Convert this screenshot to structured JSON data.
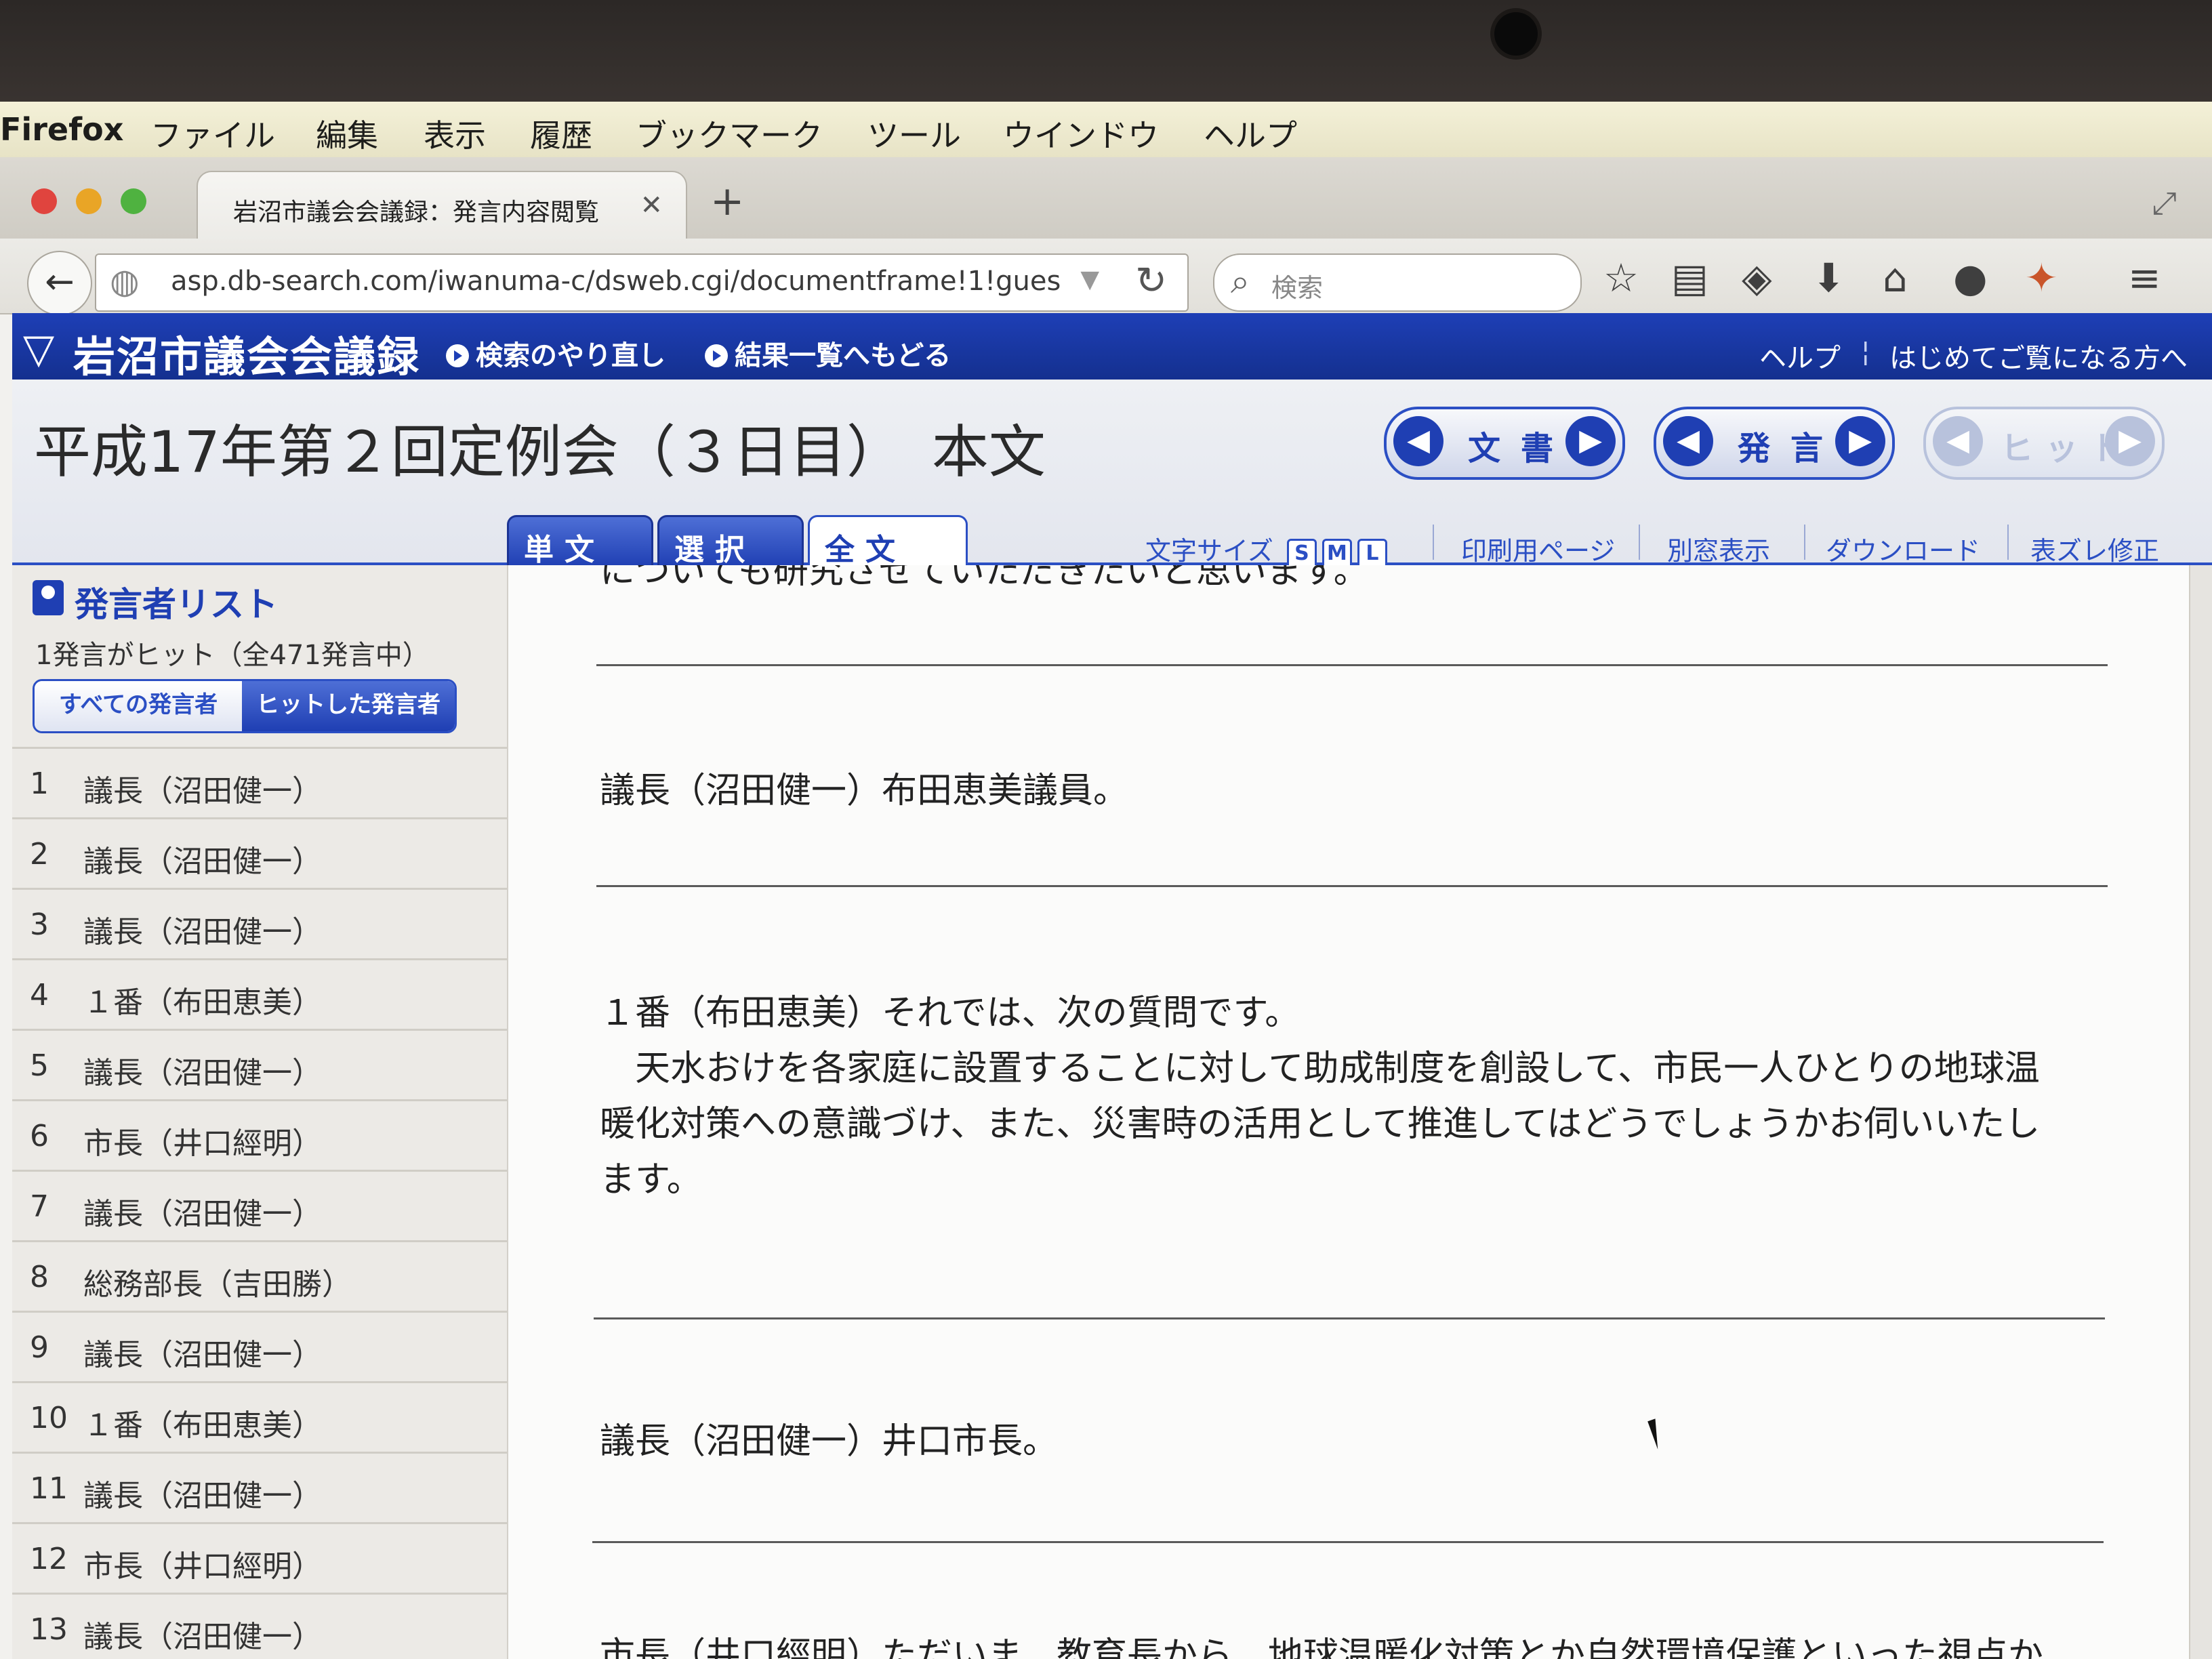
{
  "menubar": {
    "app_name": "Firefox",
    "items": [
      "ファイル",
      "編集",
      "表示",
      "履歴",
      "ブックマーク",
      "ツール",
      "ウインドウ",
      "ヘルプ"
    ]
  },
  "browser": {
    "tab_title": "岩沼市議会会議録：発言内容閲覧",
    "url": "asp.db-search.com/iwanuma-c/dsweb.cgi/documentframe!1!gues",
    "search_placeholder": "検索"
  },
  "site": {
    "logo": "岩沼市議会会議録",
    "links": [
      "検索のやり直し",
      "結果一覧へもどる"
    ],
    "right_links": [
      "ヘルプ",
      "はじめてご覧になる方へ"
    ]
  },
  "document": {
    "title": "平成17年第２回定例会（３日目）　本文",
    "nav_buttons": [
      {
        "label": "文書",
        "enabled": true
      },
      {
        "label": "発言",
        "enabled": true
      },
      {
        "label": "ヒット",
        "enabled": false
      }
    ],
    "tabs": [
      {
        "label": "単文",
        "active": false
      },
      {
        "label": "選択",
        "active": false
      },
      {
        "label": "全文",
        "active": true
      }
    ],
    "font_size_label": "文字サイズ",
    "font_sizes": [
      "S",
      "M",
      "L"
    ],
    "tools": [
      "印刷用ページ",
      "別窓表示",
      "ダウンロード",
      "表ズレ修正"
    ]
  },
  "sidebar": {
    "title": "発言者リスト",
    "hit_count": "1発言がヒット（全471発言中）",
    "filter_all": "すべての発言者",
    "filter_hit": "ヒットした発言者",
    "speakers": [
      {
        "num": "1",
        "name": "議長（沼田健一）"
      },
      {
        "num": "2",
        "name": "議長（沼田健一）"
      },
      {
        "num": "3",
        "name": "議長（沼田健一）"
      },
      {
        "num": "4",
        "name": "１番（布田恵美）"
      },
      {
        "num": "5",
        "name": "議長（沼田健一）"
      },
      {
        "num": "6",
        "name": "市長（井口經明）"
      },
      {
        "num": "7",
        "name": "議長（沼田健一）"
      },
      {
        "num": "8",
        "name": "総務部長（吉田勝）"
      },
      {
        "num": "9",
        "name": "議長（沼田健一）"
      },
      {
        "num": "10",
        "name": "１番（布田恵美）"
      },
      {
        "num": "11",
        "name": "議長（沼田健一）"
      },
      {
        "num": "12",
        "name": "市長（井口經明）"
      },
      {
        "num": "13",
        "name": "議長（沼田健一）"
      }
    ]
  },
  "body": {
    "partial_top": "についても研究させていただきたいと思います。",
    "speech1": "議長（沼田健一）布田恵美議員。",
    "speech2_lines": [
      "１番（布田恵美）それでは、次の質問です。",
      "　天水おけを各家庭に設置することに対して助成制度を創設して、市民一人ひとりの地球温",
      "暖化対策への意識づけ、また、災害時の活用として推進してはどうでしょうかお伺いいたし",
      "ます。"
    ],
    "speech3": "議長（沼田健一）井口市長。",
    "partial_bottom": "市長（井口經明）ただいま、教育長から、地球温暖化対策とか自然環境保護といった視点か"
  }
}
